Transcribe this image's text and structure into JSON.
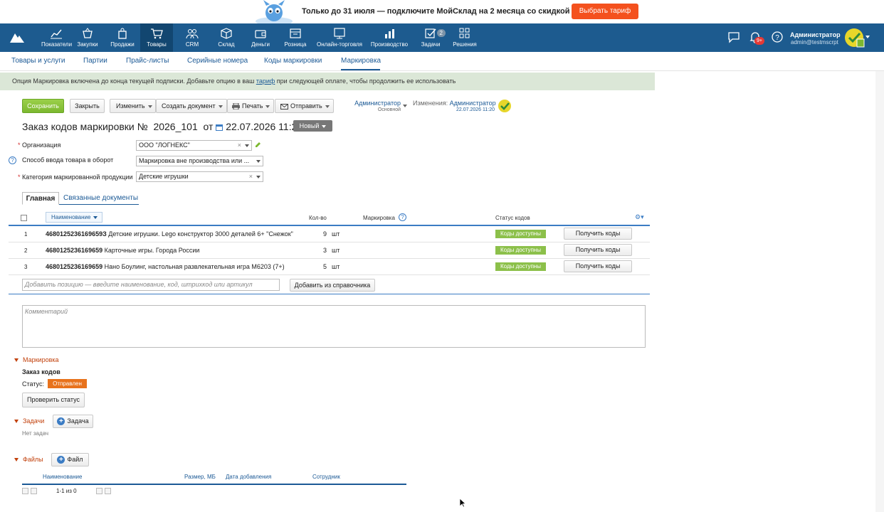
{
  "promo": {
    "text": "Только до 31 июля — подключите МойСклад на 2 месяца со скидкой 40%",
    "button": "Выбрать тариф"
  },
  "topnav": {
    "items": [
      {
        "label": "Показатели",
        "icon": "chart-icon"
      },
      {
        "label": "Закупки",
        "icon": "basket-icon"
      },
      {
        "label": "Продажи",
        "icon": "bag-icon"
      },
      {
        "label": "Товары",
        "icon": "cart-icon"
      },
      {
        "label": "CRM",
        "icon": "people-icon"
      },
      {
        "label": "Склад",
        "icon": "box-icon"
      },
      {
        "label": "Деньги",
        "icon": "wallet-icon"
      },
      {
        "label": "Розница",
        "icon": "register-icon"
      },
      {
        "label": "Онлайн-торговля",
        "icon": "monitor-icon"
      },
      {
        "label": "Производство",
        "icon": "bars-icon"
      },
      {
        "label": "Задачи",
        "icon": "check-icon",
        "badge": "2"
      },
      {
        "label": "Решения",
        "icon": "grid-icon"
      }
    ],
    "notif_badge": "9+",
    "user_name": "Администратор",
    "user_email": "admin@testmscrpt"
  },
  "subnav": {
    "items": [
      "Товары и услуги",
      "Партии",
      "Прайс-листы",
      "Серийные номера",
      "Коды маркировки",
      "Маркировка"
    ]
  },
  "info": {
    "before": "Опция Маркировка включена до конца текущей подписки. Добавьте опцию в ваш ",
    "link": "тариф",
    "after": " при следующей оплате, чтобы продолжить ее использовать"
  },
  "toolbar": {
    "save": "Сохранить",
    "close": "Закрыть",
    "edit": "Изменить",
    "create_doc": "Создать документ",
    "print": "Печать",
    "send": "Отправить"
  },
  "owner": {
    "name": "Администратор",
    "group": "Основной",
    "changes_label": "Изменения:",
    "changes_user": "Администратор",
    "changes_date": "22.07.2026 11:20"
  },
  "doc": {
    "title": "Заказ кодов маркировки №",
    "number": "2026_101",
    "from": "от",
    "date": "22.07.2026 11:20",
    "status": "Новый"
  },
  "form": {
    "org_label": "Организация",
    "org_value": "ООО \"ЛОГНЕКС\"",
    "method_label": "Способ ввода товара в оборот",
    "method_value": "Маркировка вне производства или ...",
    "category_label": "Категория маркированной продукции",
    "category_value": "Детские игрушки"
  },
  "tabs": {
    "main": "Главная",
    "related": "Связанные документы"
  },
  "table": {
    "headers": {
      "name": "Наименование",
      "qty": "Кол-во",
      "marking": "Маркировка",
      "status": "Статус кодов"
    },
    "rows": [
      {
        "num": "1",
        "code": "4680125236169659З",
        "name": "Детские игрушки. Lego конструктор 3000 деталей 6+ \"Снежок\"",
        "qty": "9",
        "unit": "шт",
        "status": "Коды доступны",
        "action": "Получить коды"
      },
      {
        "num": "2",
        "code": "4680125236169659",
        "name": "Карточные игры. Города России",
        "qty": "3",
        "unit": "шт",
        "status": "Коды доступны",
        "action": "Получить коды"
      },
      {
        "num": "3",
        "code": "4680125236169659",
        "name": "Нано Боулинг, настольная развлекательная игра M6203 (7+)",
        "qty": "5",
        "unit": "шт",
        "status": "Коды доступны",
        "action": "Получить коды"
      }
    ],
    "add_placeholder": "Добавить позицию — введите наименование, код, штрихкод или артикул",
    "add_from_catalog": "Добавить из справочника"
  },
  "comment_placeholder": "Комментарий",
  "marking_section": {
    "title": "Маркировка",
    "order_title": "Заказ кодов",
    "status_label": "Статус:",
    "status_value": "Отправлен",
    "check_button": "Проверить статус"
  },
  "tasks_section": {
    "title": "Задачи",
    "add_button": "Задача",
    "empty": "Нет задач"
  },
  "files_section": {
    "title": "Файлы",
    "add_button": "Файл",
    "headers": [
      "Наименование",
      "Размер, МБ",
      "Дата добавления",
      "Сотрудник"
    ],
    "pager": "1-1 из 0"
  }
}
